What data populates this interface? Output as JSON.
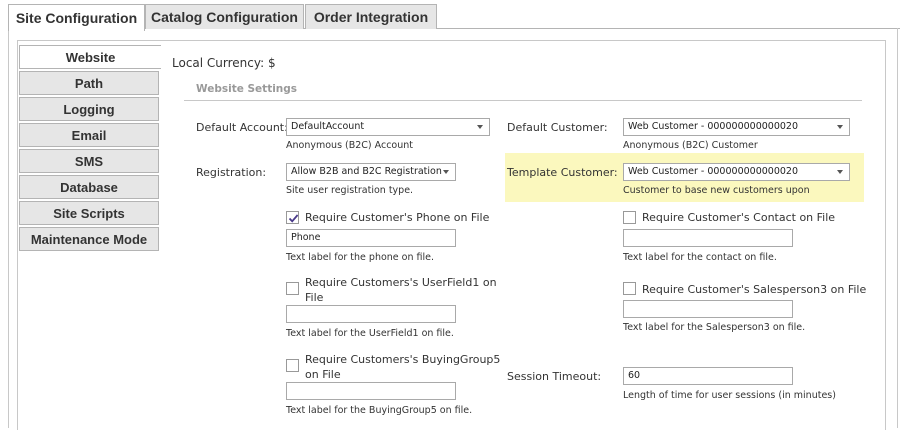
{
  "top_tabs": [
    "Site Configuration",
    "Catalog Configuration",
    "Order Integration"
  ],
  "side_tabs": [
    "Website",
    "Path",
    "Logging",
    "Email",
    "SMS",
    "Database",
    "Site Scripts",
    "Maintenance Mode"
  ],
  "local_currency": "Local Currency: $",
  "section_title": "Website Settings",
  "default_account": {
    "label": "Default Account:",
    "value": "DefaultAccount",
    "help": "Anonymous (B2C) Account"
  },
  "default_customer": {
    "label": "Default Customer:",
    "value": "Web Customer - 000000000000020",
    "help": "Anonymous (B2C) Customer"
  },
  "registration": {
    "label": "Registration:",
    "value": "Allow B2B and B2C Registration",
    "help": "Site user registration type."
  },
  "template_customer": {
    "label": "Template Customer:",
    "value": "Web Customer - 000000000000020",
    "help": "Customer to base new customers upon"
  },
  "req_phone": {
    "label": "Require Customer's Phone on File",
    "checked": true,
    "value": "Phone",
    "help": "Text label for the phone on file."
  },
  "req_contact": {
    "label": "Require Customer's Contact on File",
    "checked": false,
    "value": "",
    "help": "Text label for the contact on file."
  },
  "req_userfield1": {
    "label_line1": "Require Customers's UserField1 on",
    "label_line2": "File",
    "checked": false,
    "value": "",
    "help": "Text label for the UserField1 on file."
  },
  "req_salesperson3": {
    "label": "Require Customer's Salesperson3 on File",
    "checked": false,
    "value": "",
    "help": "Text label for the Salesperson3 on file."
  },
  "req_buyinggroup5": {
    "label_line1": "Require Customers's BuyingGroup5",
    "label_line2": "on File",
    "checked": false,
    "value": "",
    "help": "Text label for the BuyingGroup5 on file."
  },
  "session_timeout": {
    "label": "Session Timeout:",
    "value": "60",
    "help": "Length of time for user sessions (in minutes)"
  },
  "colors": {
    "highlight": "#fbf8be",
    "checkmark": "#4a3a8a"
  }
}
